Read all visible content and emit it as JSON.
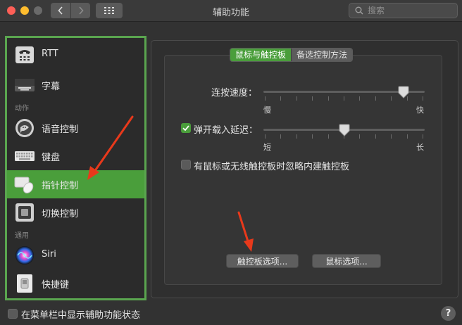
{
  "window": {
    "title": "辅助功能",
    "search_placeholder": "搜索"
  },
  "sidebar": {
    "sections": {
      "actions": "动作",
      "general": "通用"
    },
    "items": [
      {
        "label": "RTT",
        "icon": "tty-phone-icon"
      },
      {
        "label": "字幕",
        "icon": "captions-icon"
      },
      {
        "label": "语音控制",
        "icon": "voice-control-icon"
      },
      {
        "label": "键盘",
        "icon": "keyboard-icon"
      },
      {
        "label": "指针控制",
        "icon": "pointer-control-icon",
        "active": true
      },
      {
        "label": "切换控制",
        "icon": "switch-control-icon"
      },
      {
        "label": "Siri",
        "icon": "siri-icon"
      },
      {
        "label": "快捷键",
        "icon": "shortcut-icon"
      }
    ]
  },
  "tabs": [
    {
      "label": "鼠标与触控板",
      "selected": true
    },
    {
      "label": "备选控制方法",
      "selected": false
    }
  ],
  "double_click": {
    "label": "连按速度：",
    "min_label": "慢",
    "max_label": "快",
    "value_fraction": 0.87
  },
  "spring_loading": {
    "label": "弹开载入延迟：",
    "checked": true,
    "min_label": "短",
    "max_label": "长",
    "value_fraction": 0.5
  },
  "ignore_trackpad": {
    "label": "有鼠标或无线触控板时忽略内建触控板",
    "checked": false
  },
  "buttons": {
    "trackpad_options": "触控板选项...",
    "mouse_options": "鼠标选项..."
  },
  "footer": {
    "show_in_menubar": "在菜单栏中显示辅助功能状态",
    "checked": false,
    "help": "?"
  },
  "colors": {
    "accent_green": "#4a9e3b",
    "annotation_red": "#e8391b"
  }
}
